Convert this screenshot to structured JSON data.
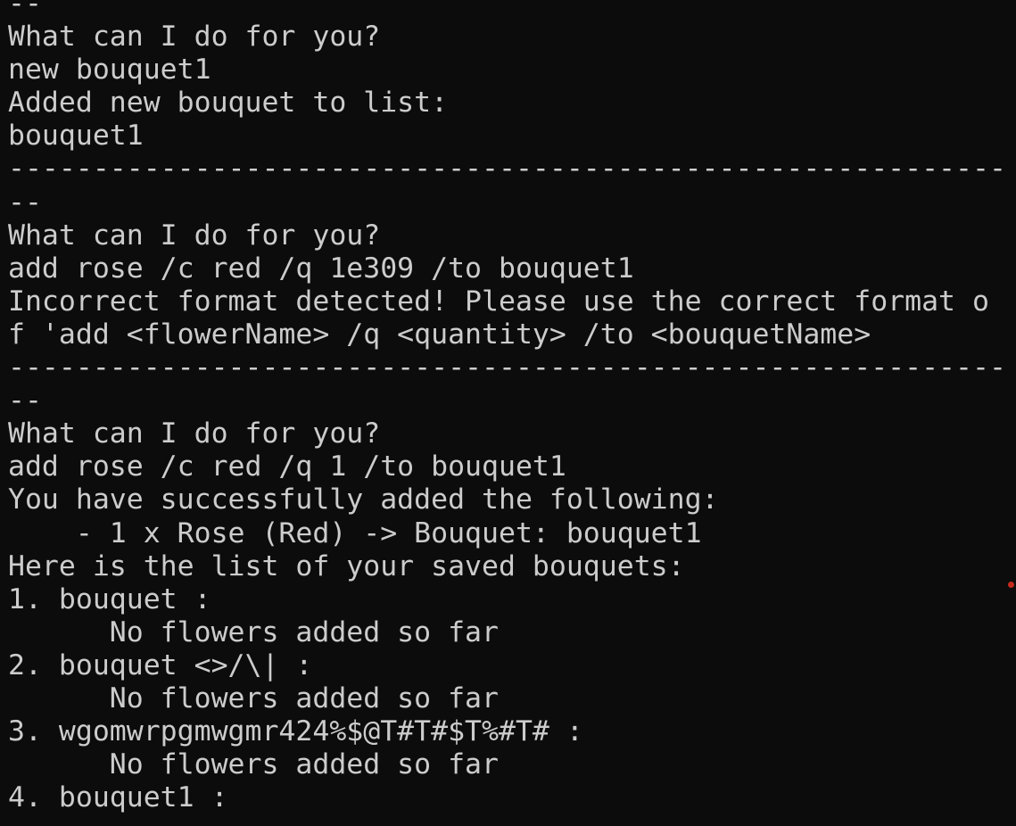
{
  "colors": {
    "background": "#0c0c0c",
    "foreground": "#cccccc",
    "indicator_dot": "#c42b1c"
  },
  "terminal": {
    "lines": [
      "--",
      "What can I do for you?",
      "new bouquet1",
      "Added new bouquet to list:",
      "bouquet1",
      "-----------------------------------------------------------",
      "--",
      "What can I do for you?",
      "add rose /c red /q 1e309 /to bouquet1",
      "Incorrect format detected! Please use the correct format o",
      "f 'add <flowerName> /q <quantity> /to <bouquetName>",
      "-----------------------------------------------------------",
      "--",
      "What can I do for you?",
      "add rose /c red /q 1 /to bouquet1",
      "You have successfully added the following:",
      "    - 1 x Rose (Red) -> Bouquet: bouquet1",
      "Here is the list of your saved bouquets:",
      "1. bouquet :",
      "      No flowers added so far",
      "2. bouquet <>/\\| :",
      "      No flowers added so far",
      "3. wgomwrpgmwgmr424%$@T#T#$T%#T# :",
      "      No flowers added so far",
      "4. bouquet1 :"
    ]
  }
}
